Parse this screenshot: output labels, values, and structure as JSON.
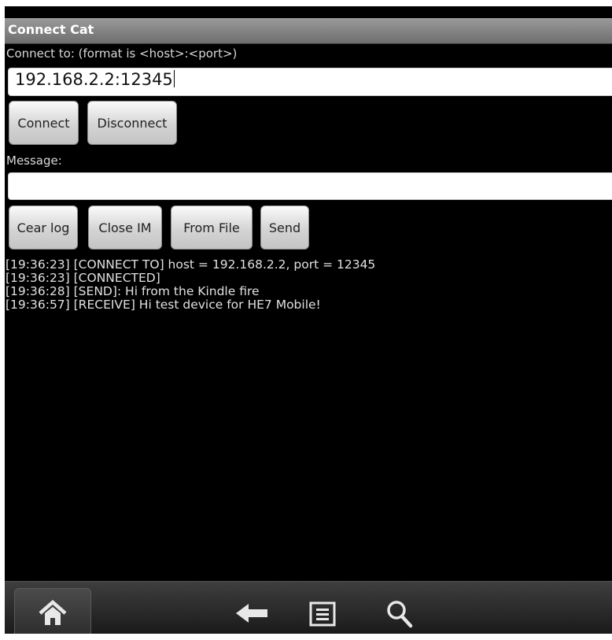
{
  "app": {
    "title": "Connect Cat"
  },
  "connect": {
    "label": "Connect to: (format is <host>:<port>)",
    "value": "192.168.2.2:12345"
  },
  "buttons_row1": {
    "connect": "Connect",
    "disconnect": "Disconnect"
  },
  "message": {
    "label": "Message:",
    "value": ""
  },
  "buttons_row2": {
    "clear_log": "Cear log",
    "close_im": "Close IM",
    "from_file": "From File",
    "send": "Send"
  },
  "log": [
    "[19:36:23] [CONNECT TO] host = 192.168.2.2, port = 12345",
    "[19:36:23] [CONNECTED]",
    "[19:36:28] [SEND]: Hi from the Kindle fire",
    "[19:36:57] [RECEIVE] Hi test device for HE7 Mobile!"
  ],
  "navbar": {
    "icons": [
      "home-icon",
      "back-icon",
      "menu-icon",
      "search-icon"
    ]
  },
  "colors": {
    "background": "#000000",
    "titlebar": "#8a8a8a",
    "text": "#e0e0e0"
  }
}
